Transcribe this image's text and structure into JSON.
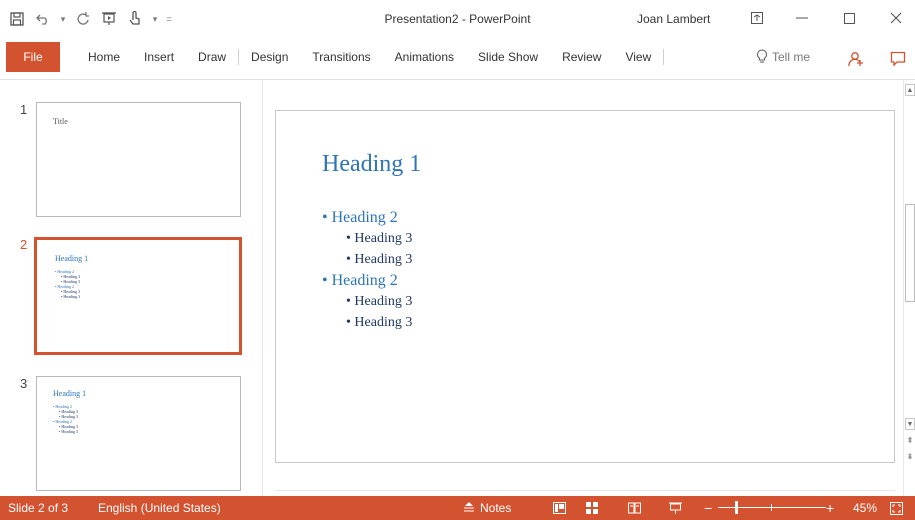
{
  "window": {
    "title": "Presentation2 - PowerPoint",
    "user": "Joan Lambert"
  },
  "qat": {
    "icons": [
      "save-icon",
      "undo-icon",
      "redo-icon",
      "start-from-beginning-icon",
      "touch-mouse-mode-icon",
      "customize-qat-icon"
    ]
  },
  "ribbon": {
    "file_label": "File",
    "tabs": [
      "Home",
      "Insert",
      "Draw",
      "Design",
      "Transitions",
      "Animations",
      "Slide Show",
      "Review",
      "View"
    ],
    "tell_me": "Tell me",
    "accent": "#d35230"
  },
  "thumbnails": {
    "items": [
      {
        "number": "1",
        "title": "Title"
      },
      {
        "number": "2",
        "heading": "Heading 1",
        "lines": [
          {
            "level": 2,
            "text": "Heading 2"
          },
          {
            "level": 3,
            "text": "Heading 3"
          },
          {
            "level": 3,
            "text": "Heading 3"
          },
          {
            "level": 2,
            "text": "Heading 2"
          },
          {
            "level": 3,
            "text": "Heading 3"
          },
          {
            "level": 3,
            "text": "Heading 3"
          }
        ]
      },
      {
        "number": "3",
        "heading": "Heading 1",
        "lines": [
          {
            "level": 2,
            "text": "Heading 2"
          },
          {
            "level": 3,
            "text": "Heading 3"
          },
          {
            "level": 3,
            "text": "Heading 3"
          },
          {
            "level": 2,
            "text": "Heading 2"
          },
          {
            "level": 3,
            "text": "Heading 3"
          },
          {
            "level": 3,
            "text": "Heading 3"
          }
        ]
      }
    ],
    "active_index": 1
  },
  "slide": {
    "heading": "Heading 1",
    "bullets": [
      {
        "level": 2,
        "text": "• Heading 2"
      },
      {
        "level": 3,
        "text": "• Heading 3"
      },
      {
        "level": 3,
        "text": "• Heading 3"
      },
      {
        "level": 2,
        "text": "• Heading 2"
      },
      {
        "level": 3,
        "text": "• Heading 3"
      },
      {
        "level": 3,
        "text": "• Heading 3"
      }
    ],
    "heading_color": "#2e75b6",
    "subheading_color": "#1f3864"
  },
  "statusbar": {
    "slide_info": "Slide 2 of 3",
    "language": "English (United States)",
    "notes_label": "Notes",
    "zoom_minus": "−",
    "zoom_plus": "+",
    "zoom_level": "45%",
    "zoom_fraction": 0.45
  }
}
